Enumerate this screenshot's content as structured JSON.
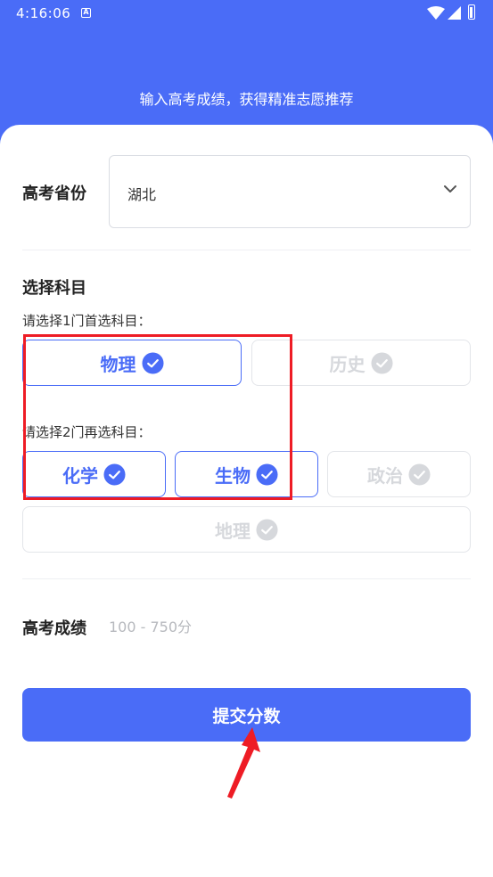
{
  "status_bar": {
    "time": "4:16:06",
    "sim_badge": "A",
    "icons": [
      "wifi-icon",
      "signal-icon",
      "battery-icon"
    ]
  },
  "header": {
    "subtitle": "输入高考成绩，获得精准志愿推荐",
    "color": "#4a6cf7"
  },
  "province": {
    "label": "高考省份",
    "value": "湖北"
  },
  "subjects": {
    "title": "选择科目",
    "first_hint": "请选择1门首选科目：",
    "first_options": [
      {
        "label": "物理",
        "selected": true
      },
      {
        "label": "历史",
        "selected": false
      }
    ],
    "second_hint": "请选择2门再选科目：",
    "second_options": [
      {
        "label": "化学",
        "selected": true
      },
      {
        "label": "生物",
        "selected": true
      },
      {
        "label": "政治",
        "selected": false
      },
      {
        "label": "地理",
        "selected": false
      }
    ]
  },
  "score": {
    "label": "高考成绩",
    "placeholder": "100 - 750分",
    "value": ""
  },
  "submit": {
    "label": "提交分数"
  },
  "colors": {
    "accent": "#4a6cf7",
    "annotation": "#ee1c25",
    "disabled": "#d6d8dc"
  }
}
